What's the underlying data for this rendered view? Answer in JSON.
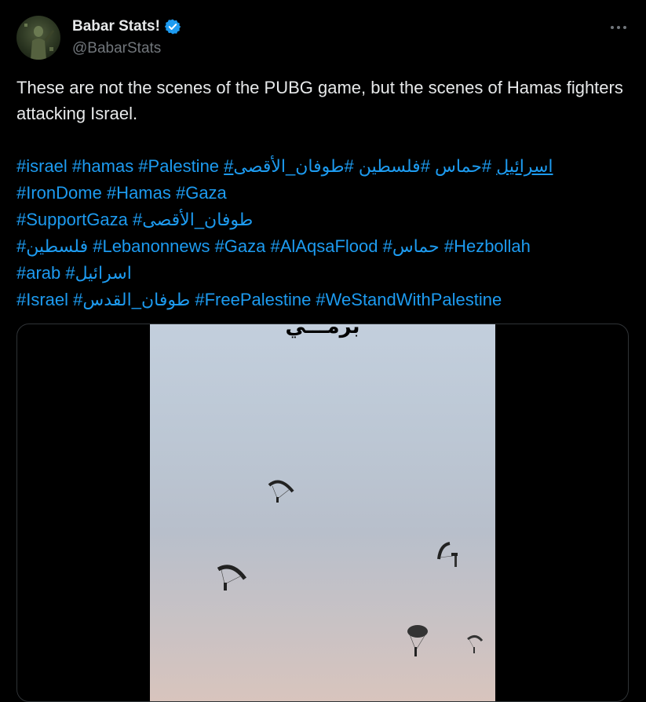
{
  "author": {
    "display_name": "Babar Stats!",
    "handle": "@BabarStats",
    "verified": true
  },
  "more_label": "···",
  "tweet": {
    "text": "These are not the scenes of the PUBG game, but the scenes of Hamas fighters attacking Israel."
  },
  "hashtag_lines": [
    [
      "#israel",
      "#hamas",
      "#Palestine",
      "#اسرائيل",
      "#حماس",
      "#فلسطين",
      "#طوفان_الأقصى"
    ],
    [
      "#IronDome",
      "#Hamas",
      "#Gaza"
    ],
    [
      "#SupportGaza",
      "#طوفان_الأقصى"
    ],
    [
      "#فلسطين",
      "#Lebanonnews",
      "#Gaza",
      "#AlAqsaFlood",
      "#حماس",
      "#Hezbollah"
    ],
    [
      "#arab",
      "#اسرائيل"
    ],
    [
      "#Israel",
      "#طوفان_القدس",
      "#FreePalestine",
      "#WeStandWithPalestine"
    ]
  ],
  "hashtag_text": {
    "line1": "#israel  #hamas #Palestine ",
    "line1_ul": "#اسرائيل",
    "line1_rest": " #حماس #فلسطين #طوفان_الأقصى",
    "line2": "#IronDome #Hamas #Gaza",
    "line3": "#SupportGaza #طوفان_الأقصى",
    "line4": "#فلسطين #Lebanonnews #Gaza #AlAqsaFlood #حماس #Hezbollah",
    "line5": "#arab #اسرائيل",
    "line6": " #Israel  #طوفان_القدس #FreePalestine #WeStandWithPalestine"
  },
  "media": {
    "caption_text": "برمـــي"
  },
  "colors": {
    "link": "#1d9bf0",
    "text": "#e7e9ea",
    "muted": "#71767b",
    "background": "#000000",
    "verified": "#1d9bf0"
  }
}
